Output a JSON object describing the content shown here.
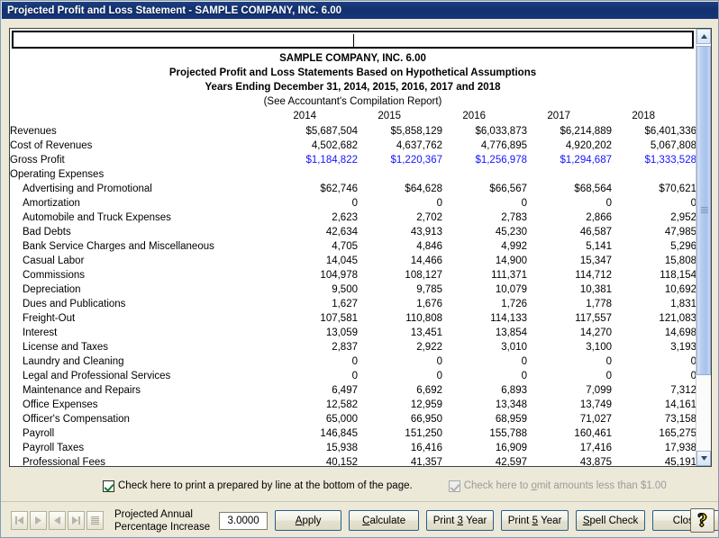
{
  "window": {
    "title": "Projected Profit and Loss Statement - SAMPLE COMPANY, INC. 6.00",
    "titlebar_color": "#16357a"
  },
  "edit_field": {
    "value": ""
  },
  "report": {
    "company": "SAMPLE COMPANY, INC. 6.00",
    "statement_title": "Projected Profit and Loss Statements Based on Hypothetical Assumptions",
    "period": "Years Ending December 31, 2014, 2015, 2016, 2017 and 2018",
    "note": "(See Accountant's Compilation Report)",
    "columns": [
      "2014",
      "2015",
      "2016",
      "2017",
      "2018"
    ],
    "highlight_color": "#1414ff",
    "rows": [
      {
        "label": "Revenues",
        "indent": false,
        "blue": false,
        "values": [
          "$5,687,504",
          "$5,858,129",
          "$6,033,873",
          "$6,214,889",
          "$6,401,336"
        ]
      },
      {
        "label": "Cost of Revenues",
        "indent": false,
        "blue": false,
        "values": [
          "4,502,682",
          "4,637,762",
          "4,776,895",
          "4,920,202",
          "5,067,808"
        ]
      },
      {
        "label": "Gross Profit",
        "indent": false,
        "blue": true,
        "values": [
          "$1,184,822",
          "$1,220,367",
          "$1,256,978",
          "$1,294,687",
          "$1,333,528"
        ]
      },
      {
        "label": "Operating Expenses",
        "indent": false,
        "blue": false,
        "values": [
          "",
          "",
          "",
          "",
          ""
        ]
      },
      {
        "label": "Advertising and Promotional",
        "indent": true,
        "blue": false,
        "values": [
          "$62,746",
          "$64,628",
          "$66,567",
          "$68,564",
          "$70,621"
        ]
      },
      {
        "label": "Amortization",
        "indent": true,
        "blue": false,
        "values": [
          "0",
          "0",
          "0",
          "0",
          "0"
        ]
      },
      {
        "label": "Automobile and Truck Expenses",
        "indent": true,
        "blue": false,
        "values": [
          "2,623",
          "2,702",
          "2,783",
          "2,866",
          "2,952"
        ]
      },
      {
        "label": "Bad Debts",
        "indent": true,
        "blue": false,
        "values": [
          "42,634",
          "43,913",
          "45,230",
          "46,587",
          "47,985"
        ]
      },
      {
        "label": "Bank Service Charges and Miscellaneous",
        "indent": true,
        "blue": false,
        "values": [
          "4,705",
          "4,846",
          "4,992",
          "5,141",
          "5,296"
        ]
      },
      {
        "label": "Casual Labor",
        "indent": true,
        "blue": false,
        "values": [
          "14,045",
          "14,466",
          "14,900",
          "15,347",
          "15,808"
        ]
      },
      {
        "label": "Commissions",
        "indent": true,
        "blue": false,
        "values": [
          "104,978",
          "108,127",
          "111,371",
          "114,712",
          "118,154"
        ]
      },
      {
        "label": "Depreciation",
        "indent": true,
        "blue": false,
        "values": [
          "9,500",
          "9,785",
          "10,079",
          "10,381",
          "10,692"
        ]
      },
      {
        "label": "Dues and Publications",
        "indent": true,
        "blue": false,
        "values": [
          "1,627",
          "1,676",
          "1,726",
          "1,778",
          "1,831"
        ]
      },
      {
        "label": "Freight-Out",
        "indent": true,
        "blue": false,
        "values": [
          "107,581",
          "110,808",
          "114,133",
          "117,557",
          "121,083"
        ]
      },
      {
        "label": "Interest",
        "indent": true,
        "blue": false,
        "values": [
          "13,059",
          "13,451",
          "13,854",
          "14,270",
          "14,698"
        ]
      },
      {
        "label": "License and Taxes",
        "indent": true,
        "blue": false,
        "values": [
          "2,837",
          "2,922",
          "3,010",
          "3,100",
          "3,193"
        ]
      },
      {
        "label": "Laundry and Cleaning",
        "indent": true,
        "blue": false,
        "values": [
          "0",
          "0",
          "0",
          "0",
          "0"
        ]
      },
      {
        "label": "Legal and Professional Services",
        "indent": true,
        "blue": false,
        "values": [
          "0",
          "0",
          "0",
          "0",
          "0"
        ]
      },
      {
        "label": "Maintenance and Repairs",
        "indent": true,
        "blue": false,
        "values": [
          "6,497",
          "6,692",
          "6,893",
          "7,099",
          "7,312"
        ]
      },
      {
        "label": "Office Expenses",
        "indent": true,
        "blue": false,
        "values": [
          "12,582",
          "12,959",
          "13,348",
          "13,749",
          "14,161"
        ]
      },
      {
        "label": "Officer's Compensation",
        "indent": true,
        "blue": false,
        "values": [
          "65,000",
          "66,950",
          "68,959",
          "71,027",
          "73,158"
        ]
      },
      {
        "label": "Payroll",
        "indent": true,
        "blue": false,
        "values": [
          "146,845",
          "151,250",
          "155,788",
          "160,461",
          "165,275"
        ]
      },
      {
        "label": "Payroll Taxes",
        "indent": true,
        "blue": false,
        "values": [
          "15,938",
          "16,416",
          "16,909",
          "17,416",
          "17,938"
        ]
      },
      {
        "label": "Professional Fees",
        "indent": true,
        "blue": false,
        "values": [
          "40,152",
          "41,357",
          "42,597",
          "43,875",
          "45,191"
        ]
      }
    ]
  },
  "options": {
    "print_prepared_by": {
      "label": "Check here to print a prepared by line at the bottom of the page.",
      "checked": true,
      "enabled": true
    },
    "omit_amounts": {
      "label_pre": "Check here to ",
      "label_accel": "o",
      "label_post": "mit amounts less than $1.00",
      "checked": true,
      "enabled": false
    }
  },
  "toolbar": {
    "nav": {
      "first": "first-record",
      "next": "next-record",
      "previous": "previous-record",
      "last": "last-record",
      "list": "list-view"
    },
    "increase_label_line1": "Projected Annual",
    "increase_label_line2": "Percentage Increase",
    "percent_value": "3.0000",
    "buttons": [
      {
        "name": "apply-button",
        "pre": "A",
        "accel": "",
        "label": "Apply",
        "accel_index": 0
      },
      {
        "name": "calculate-button",
        "label": "Calculate",
        "accel_index": 0
      },
      {
        "name": "print-3-year-button",
        "label": "Print 3 Year",
        "accel_index": 6
      },
      {
        "name": "print-5-year-button",
        "label": "Print 5 Year",
        "accel_index": 6
      },
      {
        "name": "spell-check-button",
        "label": "Spell Check",
        "accel_index": 0
      },
      {
        "name": "close-button",
        "label": "Close",
        "accel_index": -1
      }
    ],
    "help": "?"
  },
  "scrollbar": {
    "up_arrow": "▲",
    "down_arrow": "▼"
  }
}
